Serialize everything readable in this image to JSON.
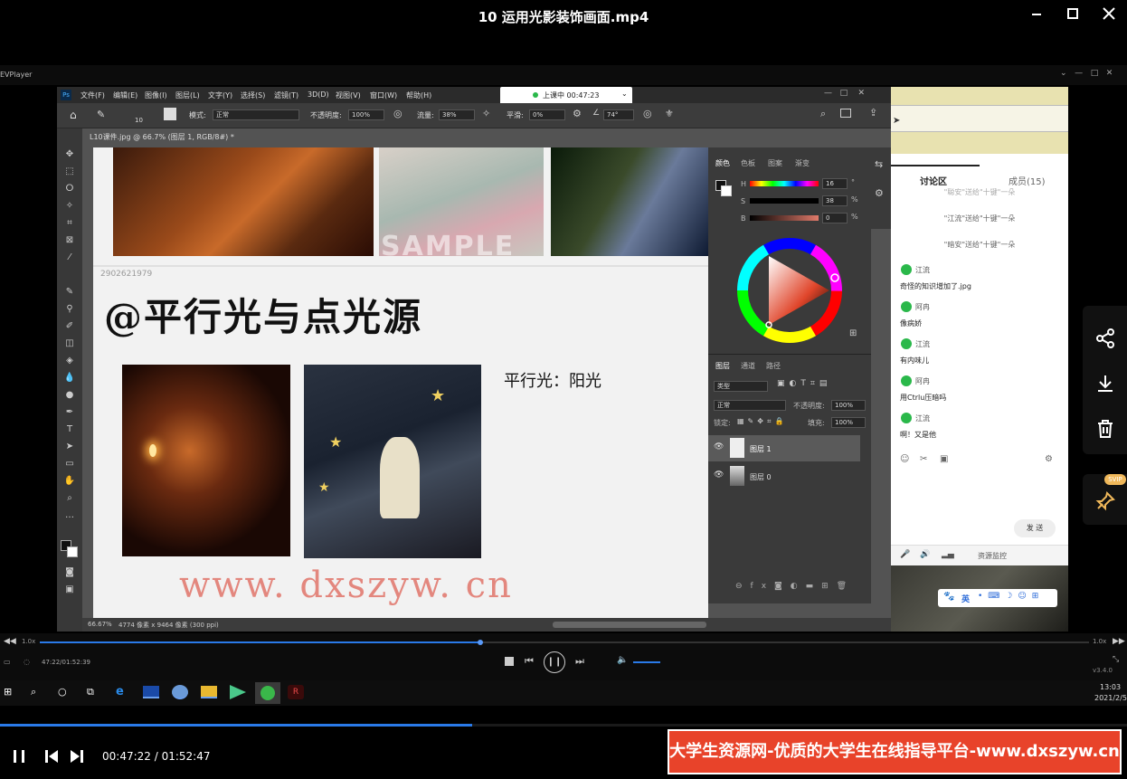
{
  "video": {
    "title": "10 运用光影装饰画面.mp4"
  },
  "evplayer": {
    "label": "EVPlayer"
  },
  "ps": {
    "menus": [
      "文件(F)",
      "编辑(E)",
      "图像(I)",
      "图层(L)",
      "文字(Y)",
      "选择(S)",
      "滤镜(T)",
      "3D(D)",
      "视图(V)",
      "窗口(W)",
      "帮助(H)"
    ],
    "live": "上课中 00:47:23",
    "options": {
      "size": "10",
      "mode_label": "模式:",
      "mode": "正常",
      "opacity_label": "不透明度:",
      "opacity": "100%",
      "flow_label": "流量:",
      "flow": "38%",
      "smooth_label": "平滑:",
      "smooth": "0%",
      "angle": "74°"
    },
    "doc_tab": "L10课件.jpg @ 66.7% (图层 1, RGB/8#) *",
    "uid": "2902621979",
    "status": {
      "zoom": "66.67%",
      "size": "4774 像素 x 9464 像素 (300 ppi)"
    },
    "heading_hw": "@平行光与点光源",
    "note_hw": "平行光：阳光",
    "sample": "SAMPLE",
    "color_panel": {
      "tabs": [
        "颜色",
        "色板",
        "图案",
        "渐变"
      ],
      "h": "16",
      "s": "38",
      "b": "0",
      "h_label": "H",
      "s_label": "S",
      "b_label": "B",
      "deg": "°",
      "pct": "%"
    },
    "layers_panel": {
      "tabs": [
        "图层",
        "通道",
        "路径"
      ],
      "filter": "类型",
      "blend": "正常",
      "opacity_label": "不透明度:",
      "opacity": "100%",
      "lock_label": "锁定:",
      "fill_label": "填充:",
      "fill": "100%",
      "layers": [
        "图层 1",
        "图层 0"
      ]
    }
  },
  "watermark": "www. dxszyw. cn",
  "chat": {
    "tabs": [
      "讨论区",
      "成员(15)"
    ],
    "partial": "\"聪安\"送给\"十键\"一朵",
    "system": [
      "\"江流\"送给\"十键\"一朵",
      "\"暗安\"送给\"十键\"一朵"
    ],
    "messages": [
      {
        "name": "江流",
        "text": "奇怪的知识增加了.jpg"
      },
      {
        "name": "阿冉",
        "text": "像病娇"
      },
      {
        "name": "江流",
        "text": "有内味儿"
      },
      {
        "name": "阿冉",
        "text": "用Ctrlu压暗吗"
      },
      {
        "name": "江流",
        "text": "啊！又是他"
      }
    ],
    "send": "发 送",
    "monitor": "资源监控",
    "ime": "英"
  },
  "player": {
    "speed": "1.0x",
    "time": "47:22/01:52:39",
    "version": "v3.4.0",
    "clock": "13:03",
    "date": "2021/2/5"
  },
  "bottom": {
    "time": "00:47:22 / 01:52:47",
    "banner": "大学生资源网-优质的大学生在线指导平台-www.dxszyw.cn"
  },
  "colors": {
    "accent": "#2ab84a",
    "banner": "#e8432a",
    "watermark": "#e27c72"
  }
}
